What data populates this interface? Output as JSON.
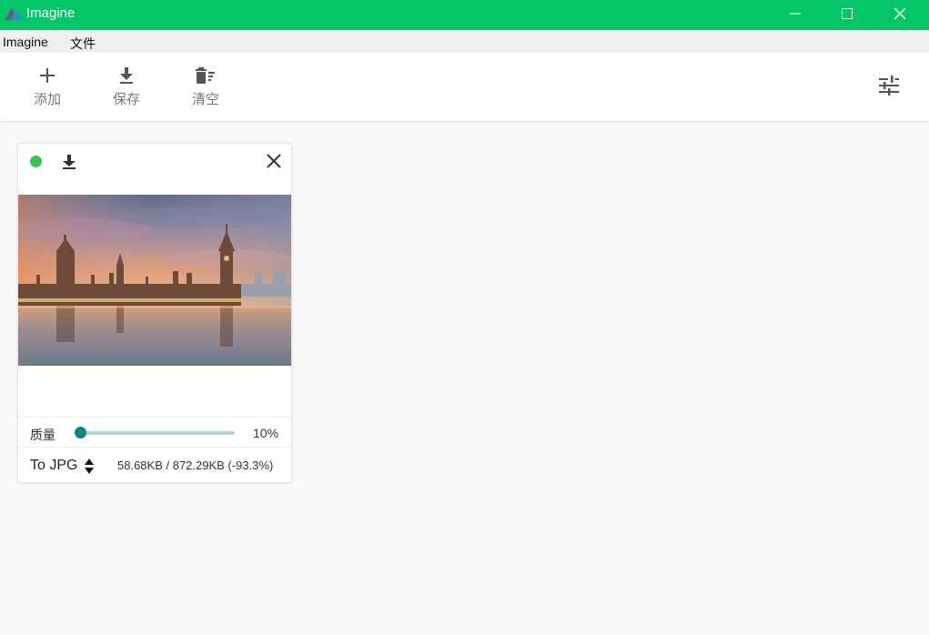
{
  "window": {
    "title": "Imagine",
    "controls": [
      "minimize",
      "maximize",
      "close"
    ]
  },
  "menu": {
    "items": [
      {
        "label": "Imagine"
      },
      {
        "label": "文件"
      }
    ]
  },
  "toolbar": {
    "add_label": "添加",
    "save_label": "保存",
    "clear_label": "清空",
    "settings_icon": "tune-icon"
  },
  "card": {
    "status_color": "#36c743",
    "image_description_icon": "image-preview",
    "quality_label": "质量",
    "quality_value": "10%",
    "quality_fraction": 0.1,
    "format": "To JPG",
    "size_info": "58.68KB / 872.29KB (-93.3%)"
  },
  "colors": {
    "titlebar": "#04c868",
    "slider_thumb": "#0a8a7e",
    "slider_track": "#a8d8d4"
  }
}
